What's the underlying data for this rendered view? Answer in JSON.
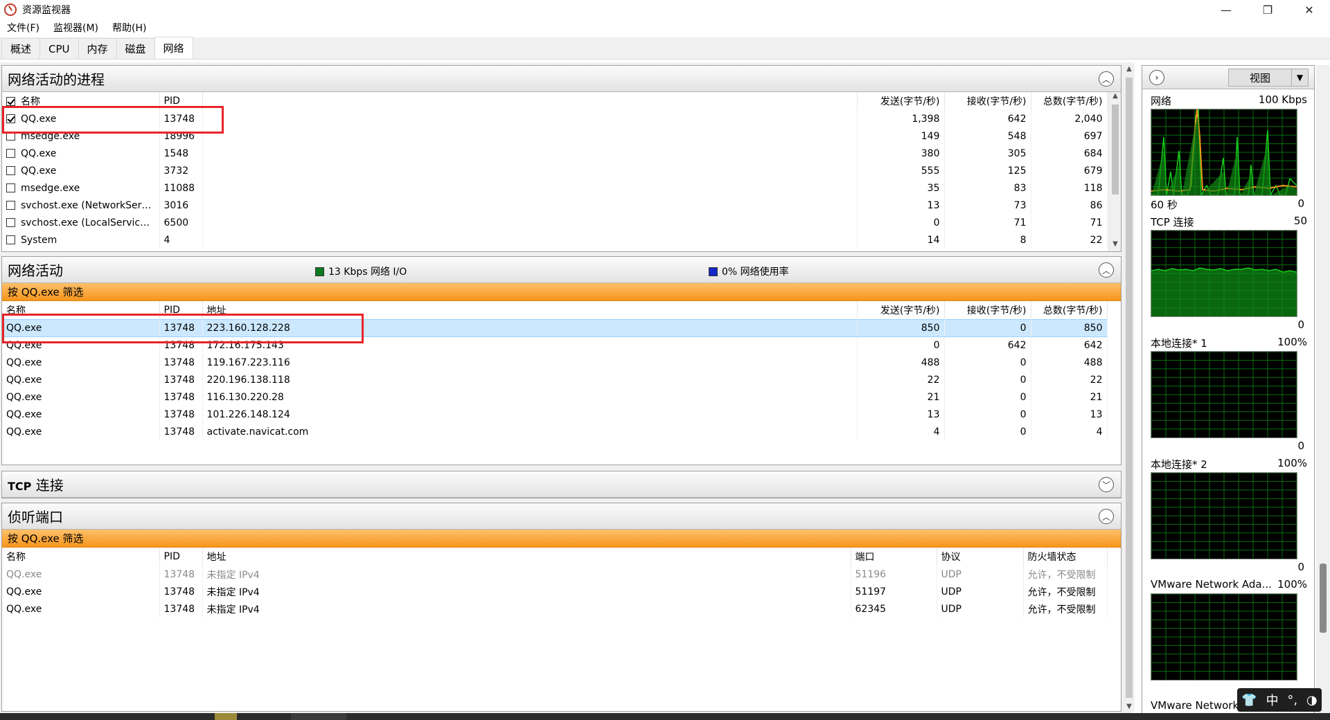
{
  "window": {
    "title": "资源监视器"
  },
  "menu": [
    "文件(F)",
    "监视器(M)",
    "帮助(H)"
  ],
  "tabs": [
    "概述",
    "CPU",
    "内存",
    "磁盘",
    "网络"
  ],
  "active_tab": 4,
  "processes": {
    "title": "网络活动的进程",
    "columns": [
      "名称",
      "PID",
      "发送(字节/秒)",
      "接收(字节/秒)",
      "总数(字节/秒)"
    ],
    "rows": [
      {
        "checked": true,
        "name": "QQ.exe",
        "pid": "13748",
        "send": "1,398",
        "recv": "642",
        "total": "2,040"
      },
      {
        "checked": false,
        "name": "msedge.exe",
        "pid": "18996",
        "send": "149",
        "recv": "548",
        "total": "697"
      },
      {
        "checked": false,
        "name": "QQ.exe",
        "pid": "1548",
        "send": "380",
        "recv": "305",
        "total": "684"
      },
      {
        "checked": false,
        "name": "QQ.exe",
        "pid": "3732",
        "send": "555",
        "recv": "125",
        "total": "679"
      },
      {
        "checked": false,
        "name": "msedge.exe",
        "pid": "11088",
        "send": "35",
        "recv": "83",
        "total": "118"
      },
      {
        "checked": false,
        "name": "svchost.exe (NetworkService...",
        "pid": "3016",
        "send": "13",
        "recv": "73",
        "total": "86"
      },
      {
        "checked": false,
        "name": "svchost.exe (LocalServiceAn...",
        "pid": "6500",
        "send": "0",
        "recv": "71",
        "total": "71"
      },
      {
        "checked": false,
        "name": "System",
        "pid": "4",
        "send": "14",
        "recv": "8",
        "total": "22"
      }
    ]
  },
  "activity": {
    "title": "网络活动",
    "legend_io": "13 Kbps 网络 I/O",
    "legend_usage": "0% 网络使用率",
    "legend_io_color": "#0b7a1f",
    "legend_usage_color": "#1427c8",
    "filter": "按 QQ.exe 筛选",
    "columns": [
      "名称",
      "PID",
      "地址",
      "发送(字节/秒)",
      "接收(字节/秒)",
      "总数(字节/秒)"
    ],
    "rows": [
      {
        "name": "QQ.exe",
        "pid": "13748",
        "addr": "223.160.128.228",
        "send": "850",
        "recv": "0",
        "total": "850"
      },
      {
        "name": "QQ.exe",
        "pid": "13748",
        "addr": "172.16.175.143",
        "send": "0",
        "recv": "642",
        "total": "642"
      },
      {
        "name": "QQ.exe",
        "pid": "13748",
        "addr": "119.167.223.116",
        "send": "488",
        "recv": "0",
        "total": "488"
      },
      {
        "name": "QQ.exe",
        "pid": "13748",
        "addr": "220.196.138.118",
        "send": "22",
        "recv": "0",
        "total": "22"
      },
      {
        "name": "QQ.exe",
        "pid": "13748",
        "addr": "116.130.220.28",
        "send": "21",
        "recv": "0",
        "total": "21"
      },
      {
        "name": "QQ.exe",
        "pid": "13748",
        "addr": "101.226.148.124",
        "send": "13",
        "recv": "0",
        "total": "13"
      },
      {
        "name": "QQ.exe",
        "pid": "13748",
        "addr": "activate.navicat.com",
        "send": "4",
        "recv": "0",
        "total": "4"
      }
    ]
  },
  "tcp": {
    "title_prefix": "TCP",
    "title_suffix": " 连接"
  },
  "listening": {
    "title": "侦听端口",
    "filter": "按 QQ.exe 筛选",
    "columns": [
      "名称",
      "PID",
      "地址",
      "端口",
      "协议",
      "防火墙状态"
    ],
    "rows": [
      {
        "name": "QQ.exe",
        "pid": "13748",
        "addr": "未指定 IPv4",
        "port": "51196",
        "proto": "UDP",
        "fw": "允许，不受限制",
        "dim": true
      },
      {
        "name": "QQ.exe",
        "pid": "13748",
        "addr": "未指定 IPv4",
        "port": "51197",
        "proto": "UDP",
        "fw": "允许，不受限制",
        "dim": false
      },
      {
        "name": "QQ.exe",
        "pid": "13748",
        "addr": "未指定 IPv4",
        "port": "62345",
        "proto": "UDP",
        "fw": "允许，不受限制",
        "dim": false
      }
    ]
  },
  "right_pane": {
    "view_label": "视图",
    "graphs": [
      {
        "label": "网络",
        "max": "100 Kbps",
        "foot_left": "60 秒",
        "foot_right": "0"
      },
      {
        "label": "TCP 连接",
        "max": "50",
        "foot_left": "",
        "foot_right": "0"
      },
      {
        "label": "本地连接* 1",
        "max": "100%",
        "foot_left": "",
        "foot_right": "0"
      },
      {
        "label": "本地连接* 2",
        "max": "100%",
        "foot_left": "",
        "foot_right": "0"
      },
      {
        "label": "VMware Network Ada...",
        "max": "100%",
        "foot_left": "",
        "foot_right": ""
      },
      {
        "label": "VMware Network",
        "max": "",
        "foot_left": "",
        "foot_right": ""
      }
    ]
  },
  "ime": {
    "lang": "中"
  },
  "colors": {
    "filter_orange": "#f7a03a",
    "selection": "#cce8ff",
    "graph_green": "#17d11a",
    "graph_orange": "#f5951c",
    "highlight_red": "#e8242a"
  }
}
